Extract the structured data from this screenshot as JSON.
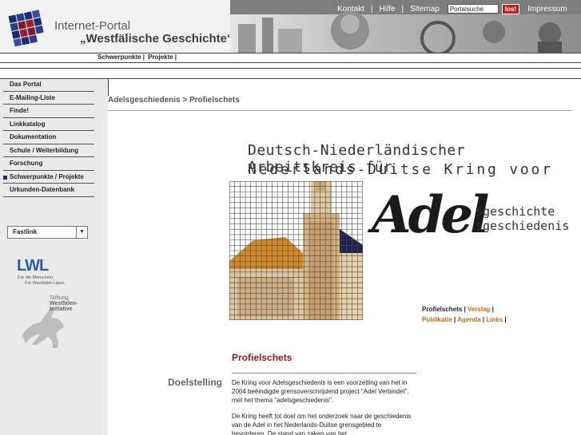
{
  "header": {
    "title_line1": "Internet-Portal",
    "title_line2": "„Westfälische Geschichte“",
    "topnav": [
      "Kontakt",
      "Hilfe",
      "Sitemap"
    ],
    "search_value": "Portalsuche",
    "search_button": "los!",
    "impressum": "Impressum"
  },
  "subnav": [
    "Schwerpunkte",
    "Projekte"
  ],
  "sidebar": {
    "items": [
      {
        "label": "Das Portal"
      },
      {
        "label": "E-Mailing-Liste"
      },
      {
        "label": "Finde!"
      },
      {
        "label": "Linkkatalog"
      },
      {
        "label": "Dokumentation"
      },
      {
        "label": "Schule / Weiterbildung"
      },
      {
        "label": "Forschung"
      },
      {
        "label": "Schwerpunkte / Projekte"
      },
      {
        "label": "Urkunden-Datenbank"
      }
    ],
    "fastlink": "Fastlink",
    "lwl_logo": "LWL",
    "lwl_tagline1": "Für die Menschen.",
    "lwl_tagline2": "Für Westfalen-Lippe.",
    "stiftung1": "Stiftung",
    "stiftung2": "Westfalen-",
    "stiftung3": "Initiative"
  },
  "breadcrumb": "Adelsgeschiedenis > Profielschets",
  "org": {
    "line1": "Deutsch-Niederländischer Arbeitskreis für",
    "line2": "Nederlands-Duitse Kring voor",
    "adel": "Adel",
    "sub1": "sgeschichte",
    "sub2": "sgeschiedenis"
  },
  "links": {
    "profielschets": "Profielschets",
    "verslag": "Verslag",
    "publikatie": "Publikatie",
    "agenda": "Agenda",
    "links": "Links"
  },
  "content": {
    "title": "Profielschets",
    "section": "Doelstelling",
    "para1": "De Kring voor Adelsgeschiedenis is een voorzetting van het in 2004 beëindigde grensoverschrijdend project \"Adel Verbindet\", met het thema \"adelsgeschiedenis\".",
    "para2": "De Kring heeft tot doel om het onderzoek naar de geschiedenis van de Adel in het Nederlands-Duitse grensgebied te bevorderen. De stand van zaken van het"
  },
  "colors": {
    "accent_red": "#8a1c1c",
    "link_orange": "#c06a14",
    "lwl_blue": "#2b5da3"
  }
}
